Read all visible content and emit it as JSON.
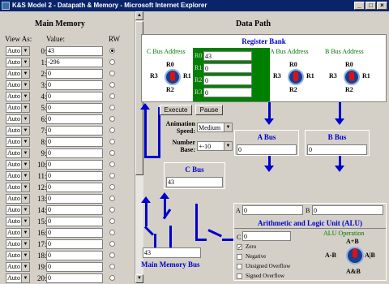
{
  "window": {
    "title": "K&S Model 2 - Datapath & Memory - Microsoft Internet Explorer"
  },
  "memory": {
    "title": "Main Memory",
    "col_view": "View As:",
    "col_value": "Value:",
    "col_rw": "RW",
    "rows": [
      {
        "mode": "Auto",
        "addr": "0",
        "value": "43",
        "selected": true
      },
      {
        "mode": "Auto",
        "addr": "1",
        "value": "-296",
        "selected": false
      },
      {
        "mode": "Auto",
        "addr": "2",
        "value": "0",
        "selected": false
      },
      {
        "mode": "Auto",
        "addr": "3",
        "value": "0",
        "selected": false
      },
      {
        "mode": "Auto",
        "addr": "4",
        "value": "0",
        "selected": false
      },
      {
        "mode": "Auto",
        "addr": "5",
        "value": "0",
        "selected": false
      },
      {
        "mode": "Auto",
        "addr": "6",
        "value": "0",
        "selected": false
      },
      {
        "mode": "Auto",
        "addr": "7",
        "value": "0",
        "selected": false
      },
      {
        "mode": "Auto",
        "addr": "8",
        "value": "0",
        "selected": false
      },
      {
        "mode": "Auto",
        "addr": "9",
        "value": "0",
        "selected": false
      },
      {
        "mode": "Auto",
        "addr": "10",
        "value": "0",
        "selected": false
      },
      {
        "mode": "Auto",
        "addr": "11",
        "value": "0",
        "selected": false
      },
      {
        "mode": "Auto",
        "addr": "12",
        "value": "0",
        "selected": false
      },
      {
        "mode": "Auto",
        "addr": "13",
        "value": "0",
        "selected": false
      },
      {
        "mode": "Auto",
        "addr": "14",
        "value": "0",
        "selected": false
      },
      {
        "mode": "Auto",
        "addr": "15",
        "value": "0",
        "selected": false
      },
      {
        "mode": "Auto",
        "addr": "16",
        "value": "0",
        "selected": false
      },
      {
        "mode": "Auto",
        "addr": "17",
        "value": "0",
        "selected": false
      },
      {
        "mode": "Auto",
        "addr": "18",
        "value": "0",
        "selected": false
      },
      {
        "mode": "Auto",
        "addr": "19",
        "value": "0",
        "selected": false
      },
      {
        "mode": "Auto",
        "addr": "20",
        "value": "0",
        "selected": false
      }
    ]
  },
  "datapath": {
    "title": "Data Path",
    "register_bank": {
      "title": "Register Bank",
      "c_bus_address": "C Bus Address",
      "a_bus_address": "A Bus Address",
      "b_bus_address": "B Bus Address",
      "registers": [
        {
          "name": "R0",
          "value": "43"
        },
        {
          "name": "R1",
          "value": "0"
        },
        {
          "name": "R2",
          "value": "0"
        },
        {
          "name": "R3",
          "value": "0"
        }
      ],
      "knob_labels": {
        "top": "R0",
        "left": "R3",
        "right": "R1",
        "bottom": "R2"
      }
    },
    "controls": {
      "execute": "Execute",
      "pause": "Pause",
      "animation_speed_label": "Animation Speed:",
      "animation_speed": "Medium",
      "number_base_label": "Number Base:",
      "number_base": "+-10"
    },
    "a_bus": {
      "title": "A Bus",
      "value": "0"
    },
    "b_bus": {
      "title": "B Bus",
      "value": "0"
    },
    "c_bus": {
      "title": "C Bus",
      "value": "43"
    },
    "main_memory_bus": {
      "title": "Main Memory Bus",
      "value": "43"
    },
    "alu": {
      "a_label": "A",
      "a_value": "0",
      "b_label": "B",
      "b_value": "0",
      "title": "Arithmetic and Logic Unit (ALU)",
      "c_label": "C",
      "c_value": "0",
      "flags": [
        {
          "label": "Zero",
          "checked": true
        },
        {
          "label": "Negative",
          "checked": false
        },
        {
          "label": "Unsigned Overflow",
          "checked": false
        },
        {
          "label": "Signed Overflow",
          "checked": false
        }
      ],
      "operation_label": "ALU Operation",
      "op_top": "A+B",
      "op_left": "A-B",
      "op_right": "A|B",
      "op_bottom": "A&B"
    }
  },
  "colors": {
    "bus": "#0000cc",
    "register_bg": "#008000",
    "title_bar": "#0a246a"
  }
}
